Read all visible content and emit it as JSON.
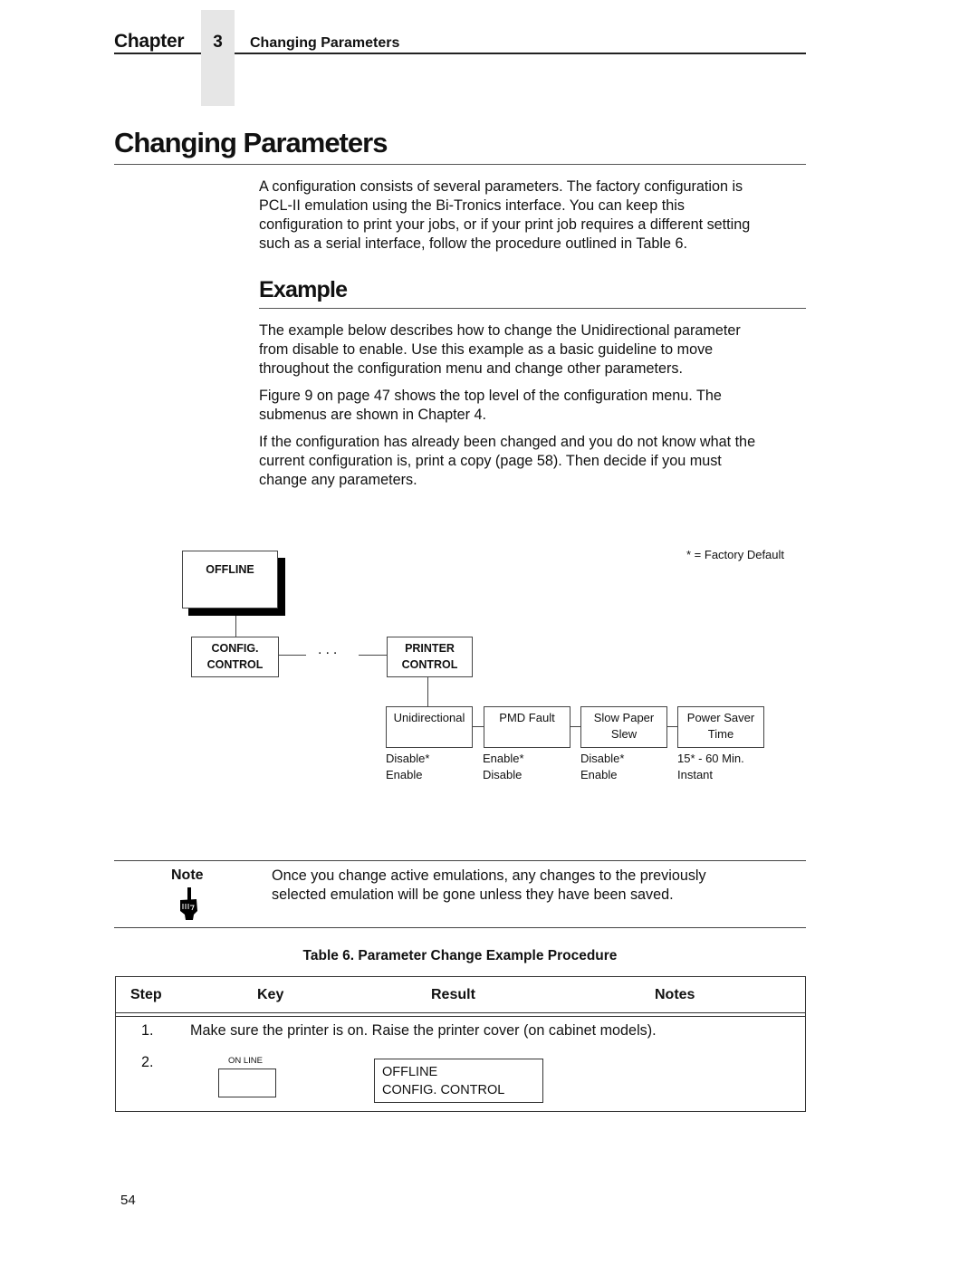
{
  "header": {
    "chapter_word": "Chapter",
    "chapter_number": "3",
    "chapter_title": "Changing Parameters"
  },
  "main": {
    "title": "Changing Parameters",
    "intro_lines": [
      "A configuration consists of several parameters. The factory configuration is",
      "PCL-II emulation using the Bi-Tronics interface. You can keep this",
      "configuration to print your jobs, or if your print job requires a different setting",
      "such as a serial interface, follow the procedure outlined in Table 6."
    ],
    "example_heading": "Example",
    "paragraphs": [
      [
        "The example below describes how to change the Unidirectional parameter",
        "from disable to enable. Use this example as a basic guideline to move",
        "throughout the configuration menu and change other parameters."
      ],
      [
        "Figure 9 on page 47 shows the top level of the configuration menu. The",
        "submenus are shown in Chapter 4."
      ],
      [
        "If the configuration has already been changed and you do not know what the",
        "current configuration is, print a copy (page 58). Then decide if you must",
        "change any parameters."
      ]
    ]
  },
  "diagram": {
    "legend": "* = Factory Default",
    "top_box": "OFFLINE",
    "config_box": [
      "CONFIG.",
      "CONTROL"
    ],
    "ellipsis": "...",
    "printer_box": [
      "PRINTER",
      "CONTROL"
    ],
    "params": [
      {
        "name": [
          "Unidirectional",
          ""
        ],
        "options": [
          "Disable*",
          "Enable"
        ]
      },
      {
        "name": [
          "PMD Fault",
          ""
        ],
        "options": [
          "Enable*",
          "Disable"
        ]
      },
      {
        "name": [
          "Slow Paper",
          "Slew"
        ],
        "options": [
          "Disable*",
          "Enable"
        ]
      },
      {
        "name": [
          "Power Saver",
          "Time"
        ],
        "options": [
          "15* - 60 Min.",
          "Instant"
        ]
      }
    ]
  },
  "note": {
    "label": "Note",
    "icon": "pointing-hand-icon",
    "lines": [
      "Once you change active emulations, any changes to the previously",
      "selected emulation will be gone unless they have been saved."
    ]
  },
  "table": {
    "title": "Table 6. Parameter Change Example Procedure",
    "headers": [
      "Step",
      "Key",
      "Result",
      "Notes"
    ],
    "rows": [
      {
        "step": "1.",
        "text": "Make sure the printer is on. Raise the printer cover (on cabinet models)."
      },
      {
        "step": "2.",
        "key_label": "ON LINE",
        "result": [
          "OFFLINE",
          "CONFIG. CONTROL"
        ],
        "notes": ""
      }
    ]
  },
  "footer": {
    "page_number": "54"
  }
}
